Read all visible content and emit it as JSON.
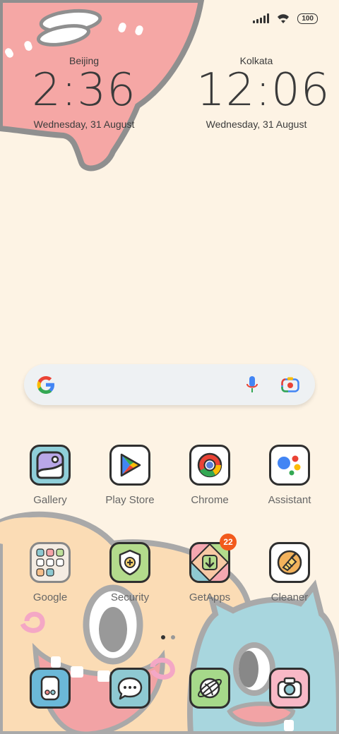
{
  "status": {
    "battery": "100"
  },
  "clocks": [
    {
      "city": "Beijing",
      "time": "2:36",
      "date": "Wednesday, 31 August"
    },
    {
      "city": "Kolkata",
      "time": "12:06",
      "date": "Wednesday, 31 August"
    }
  ],
  "apps_row1": [
    {
      "label": "Gallery",
      "icon": "gallery-icon"
    },
    {
      "label": "Play Store",
      "icon": "play-store-icon"
    },
    {
      "label": "Chrome",
      "icon": "chrome-icon"
    },
    {
      "label": "Assistant",
      "icon": "assistant-icon"
    }
  ],
  "apps_row2": [
    {
      "label": "Google",
      "icon": "google-folder-icon"
    },
    {
      "label": "Security",
      "icon": "security-icon"
    },
    {
      "label": "GetApps",
      "icon": "getapps-icon",
      "badge": "22"
    },
    {
      "label": "Cleaner",
      "icon": "cleaner-icon"
    }
  ],
  "dock": [
    {
      "icon": "phone-icon"
    },
    {
      "icon": "messages-icon"
    },
    {
      "icon": "browser-icon"
    },
    {
      "icon": "camera-icon"
    }
  ],
  "colors": {
    "accent_badge": "#f25a1c",
    "background": "#fdf3e4"
  }
}
